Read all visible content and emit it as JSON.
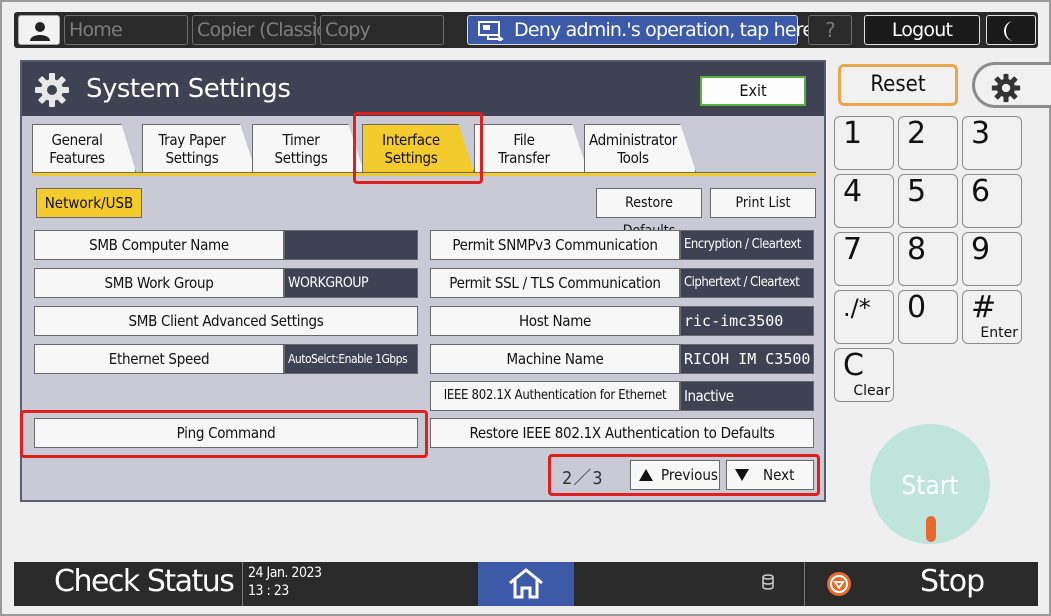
{
  "topbar": {
    "home": "Home",
    "copier_classic": "Copier (Classic)",
    "copy": "Copy",
    "deny_admin": "Deny admin.'s operation, tap here",
    "help": "?",
    "logout": "Logout"
  },
  "panel": {
    "title": "System Settings",
    "exit": "Exit",
    "tabs": [
      {
        "line1": "General",
        "line2": "Features"
      },
      {
        "line1": "Tray Paper",
        "line2": "Settings"
      },
      {
        "line1": "Timer",
        "line2": "Settings"
      },
      {
        "line1": "Interface",
        "line2": "Settings"
      },
      {
        "line1": "File",
        "line2": "Transfer"
      },
      {
        "line1": "Administrator",
        "line2": "Tools"
      }
    ],
    "sub_tab": "Network/USB",
    "restore_defaults": "Restore Defaults",
    "print_list": "Print List",
    "left_rows": [
      {
        "label": "SMB Computer Name",
        "value": ""
      },
      {
        "label": "SMB Work Group",
        "value": "WORKGROUP"
      },
      {
        "label": "SMB Client Advanced Settings"
      },
      {
        "label": "Ethernet Speed",
        "value": "AutoSelct:Enable 1Gbps"
      }
    ],
    "right_rows": [
      {
        "label": "Permit SNMPv3 Communication",
        "value": "Encryption / Cleartext"
      },
      {
        "label": "Permit SSL / TLS Communication",
        "value": "Ciphertext / Cleartext"
      },
      {
        "label": "Host Name",
        "value": "ric-imc3500"
      },
      {
        "label": "Machine Name",
        "value": "RICOH IM C3500"
      },
      {
        "label": "IEEE 802.1X Authentication for Ethernet",
        "value": "Inactive"
      }
    ],
    "ping_command": "Ping Command",
    "restore_ieee": "Restore IEEE 802.1X Authentication to Defaults",
    "page_indicator": "2／3",
    "previous": "Previous",
    "next": "Next"
  },
  "keypad": {
    "reset": "Reset",
    "keys": [
      {
        "main": "1",
        "sub": ""
      },
      {
        "main": "2",
        "sub": ""
      },
      {
        "main": "3",
        "sub": ""
      },
      {
        "main": "4",
        "sub": ""
      },
      {
        "main": "5",
        "sub": ""
      },
      {
        "main": "6",
        "sub": ""
      },
      {
        "main": "7",
        "sub": ""
      },
      {
        "main": "8",
        "sub": ""
      },
      {
        "main": "9",
        "sub": ""
      },
      {
        "main": "./*",
        "sub": ""
      },
      {
        "main": "0",
        "sub": ""
      },
      {
        "main": "#",
        "sub": "Enter"
      },
      {
        "main": "C",
        "sub": "Clear"
      }
    ],
    "start": "Start"
  },
  "bottombar": {
    "check_status": "Check Status",
    "date": "24 Jan. 2023",
    "time": "13 : 23",
    "stop": "Stop"
  }
}
